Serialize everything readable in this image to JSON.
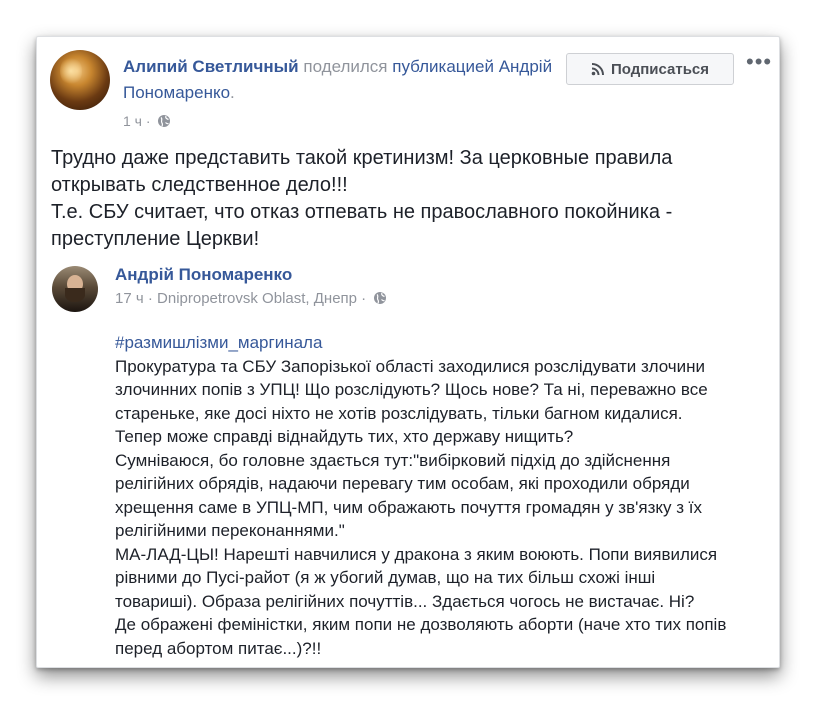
{
  "post": {
    "author": "Алипий Светличный",
    "shared_word": "поделился",
    "shared_link": "публикацией Андрій Пономаренко",
    "shared_suffix": ".",
    "time": "1 ч",
    "follow_label": "Подписаться",
    "text": [
      "Трудно даже представить такой кретинизм! За церковные правила",
      "открывать следственное дело!!!",
      "Т.е. СБУ считает, что отказ отпевать не православного покойника -",
      "преступление Церкви!"
    ]
  },
  "shared": {
    "author": "Андрій Пономаренко",
    "time": "17 ч",
    "location": "Dnipropetrovsk Oblast, Днепр",
    "hashtag": "#размишлізми_маргинала",
    "lines": [
      "Прокуратура та СБУ Запорізької області заходилися розслідувати злочини",
      "злочинних попів з УПЦ! Що розслідують? Щось нове? Та ні, переважно все",
      "старeньке, яке досі ніхто не хотів розслідувать, тільки багном кидалися.",
      "Тепер може справді віднайдуть тих, хто державу нищить?",
      "Сумніваюся, бо головне здається тут:\"вибірковий підхід до здійснення",
      "релігійних обрядів, надаючи перевагу тим особам, які проходили обряди",
      "хрещення саме в УПЦ-МП, чим ображають почуття громадян у зв'язку з їх",
      "релігійними переконаннями.\"",
      "МА-ЛАД-ЦЫ! Нарешті навчилися у дракона з яким воюють. Попи виявилися",
      "рівними до Пусі-райот (я ж убогий думав, що на тих більш схожі інші",
      "товариші). Образа релігійних почуттів... Здається чогось не вистачає. Ні?",
      "Де ображені феміністки, яким попи не дозволяють аборти (наче хто тих попів",
      "перед абортом питає...)?!!"
    ]
  },
  "icons": {
    "globe": "globe-icon",
    "rss": "rss-icon",
    "more": "more-options-icon"
  },
  "colors": {
    "link": "#365899",
    "meta": "#90949c",
    "text": "#1d2129"
  }
}
